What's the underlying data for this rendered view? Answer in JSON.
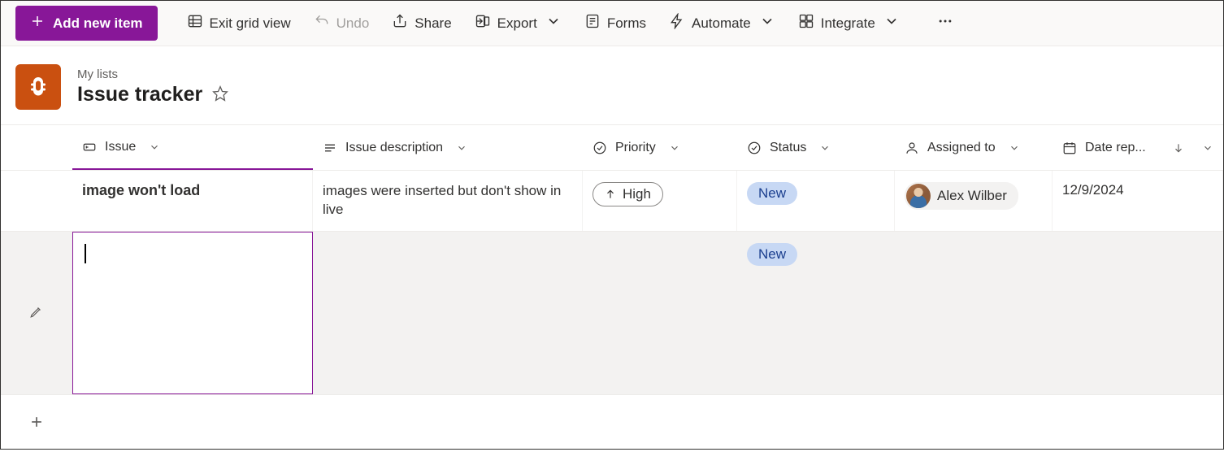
{
  "toolbar": {
    "add_new_item": "Add new item",
    "exit_grid": "Exit grid view",
    "undo": "Undo",
    "share": "Share",
    "export": "Export",
    "forms": "Forms",
    "automate": "Automate",
    "integrate": "Integrate"
  },
  "breadcrumb": "My lists",
  "title": "Issue tracker",
  "columns": {
    "issue": "Issue",
    "description": "Issue description",
    "priority": "Priority",
    "status": "Status",
    "assigned": "Assigned to",
    "date": "Date rep..."
  },
  "rows": [
    {
      "issue": "image won't load",
      "description": "images were inserted but don't show in live",
      "priority": "High",
      "status": "New",
      "assigned": "Alex Wilber",
      "date": "12/9/2024"
    },
    {
      "issue": "",
      "description": "",
      "priority": "",
      "status": "New",
      "assigned": "",
      "date": ""
    }
  ]
}
